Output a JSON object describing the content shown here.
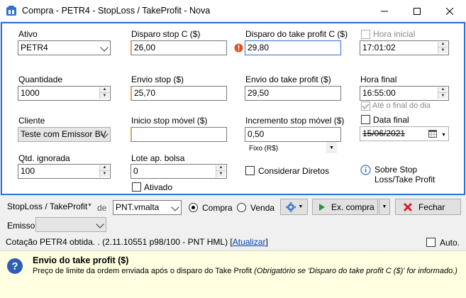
{
  "window": {
    "title": "Compra - PETR4 - StopLoss / TakeProfit - Nova"
  },
  "form": {
    "ativo_label": "Ativo",
    "ativo_value": "PETR4",
    "disparo_stop_label": "Disparo stop C ($)",
    "disparo_stop_value": "26,00",
    "disparo_take_label": "Disparo do take profit C ($)",
    "disparo_take_value": "29,80",
    "hora_inicial_label": "Hora inicial",
    "hora_inicial_value": "17:01:02",
    "quantidade_label": "Quantidade",
    "quantidade_value": "1000",
    "envio_stop_label": "Envio stop ($)",
    "envio_stop_value": "25,70",
    "envio_take_label": "Envio do take profit ($)",
    "envio_take_value": "29,50",
    "hora_final_label": "Hora final",
    "hora_final_value": "16:55:00",
    "ate_final_label": "Até o final do dia",
    "cliente_label": "Cliente",
    "cliente_value": "Teste com Emissor BV",
    "inicio_stop_movel_label": "Inicio stop móvel ($)",
    "inicio_stop_movel_value": "",
    "incremento_label": "Incremento stop móvel ($)",
    "incremento_value": "0,50",
    "incremento_tipo": "Fixo (R$)",
    "data_final_label": "Data final",
    "data_final_value": "15/06/2021",
    "qtd_ignorada_label": "Qtd. ignorada",
    "qtd_ignorada_value": "100",
    "lote_label": "Lote ap. bolsa",
    "lote_value": "0",
    "considerar_diretos_label": "Considerar Diretos",
    "ativado_label": "Ativado",
    "sobre_label": "Sobre Stop Loss/Take Profit"
  },
  "toolbar": {
    "strategy": "StopLoss / TakeProfit",
    "de_label": "de",
    "account": "PNT.vmalta",
    "compra_label": "Compra",
    "venda_label": "Venda",
    "exec_label": "Ex. compra",
    "fechar_label": "Fechar",
    "emissor_label": "Emissor"
  },
  "status": {
    "text": "Cotação PETR4 obtida. .  (2.11.10551 p98/100 - PNT HML) ",
    "link": "Atualizar",
    "link_suffix": "]",
    "link_prefix": "[",
    "auto_label": "Auto."
  },
  "help": {
    "title": "Envio do take profit ($)",
    "body": "Preço de limite da ordem enviada após o disparo do Take Profit ",
    "body_italic": "(Obrigatório se 'Disparo do take profit C ($)' for informado.)"
  },
  "colors": {
    "accent": "#2f6fd6",
    "help_bg": "#ffffe1",
    "error_icon": "#d9531e"
  }
}
